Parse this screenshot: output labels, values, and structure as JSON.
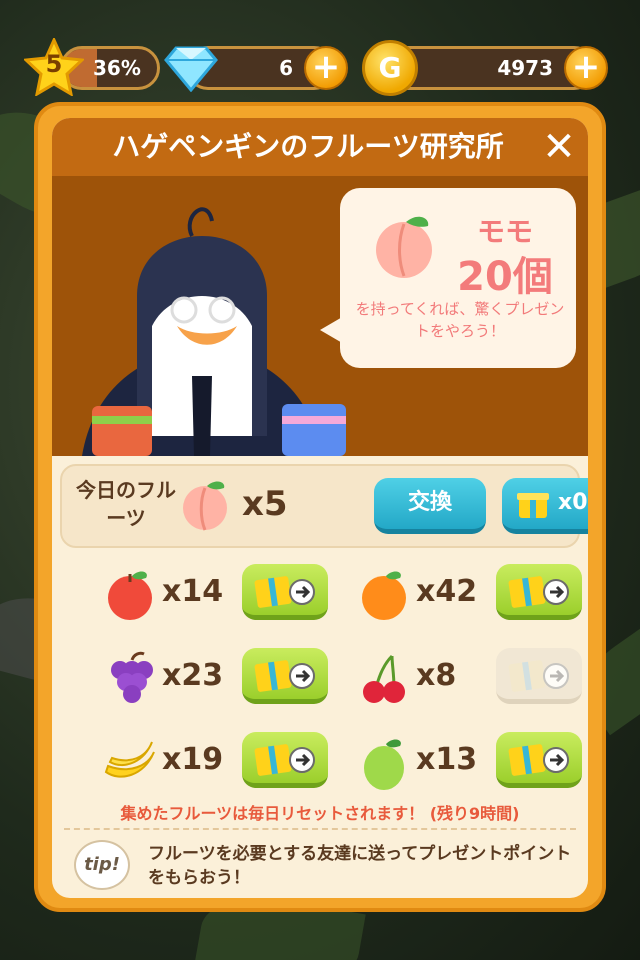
{
  "topbar": {
    "level": "5",
    "progress": "36%",
    "progress_fraction": 0.36,
    "gems": "6",
    "coin_symbol": "G",
    "coins": "4973",
    "plus_symbol": "+"
  },
  "panel": {
    "title": "ハゲペンギンのフルーツ研究所",
    "close_symbol": "✕",
    "bubble": {
      "fruit_name": "モモ",
      "fruit_count": "20個",
      "message": "を持ってくれば、驚くプレゼントをやろう！"
    },
    "today": {
      "label": "今日のフルーツ",
      "count": "x5",
      "exchange_label": "交換",
      "gift_count": "x0"
    },
    "fruits": [
      {
        "name": "apple-icon",
        "qty": "x14",
        "color": "#f04a3a",
        "enabled": true
      },
      {
        "name": "orange-icon",
        "qty": "x42",
        "color": "#ff8c1a",
        "enabled": true
      },
      {
        "name": "grape-icon",
        "qty": "x23",
        "color": "#8a3fc0",
        "enabled": true
      },
      {
        "name": "cherry-icon",
        "qty": "x8",
        "color": "#e0253a",
        "enabled": false
      },
      {
        "name": "banana-icon",
        "qty": "x19",
        "color": "#ffd21f",
        "enabled": true
      },
      {
        "name": "lime-icon",
        "qty": "x13",
        "color": "#9fd94a",
        "enabled": true
      }
    ],
    "reset_note": "集めたフルーツは毎日リセットされます！ (残り9時間)",
    "tip_badge": "tip!",
    "tip_text": "フルーツを必要とする友達に送ってプレゼントポイントをもらおう！"
  }
}
